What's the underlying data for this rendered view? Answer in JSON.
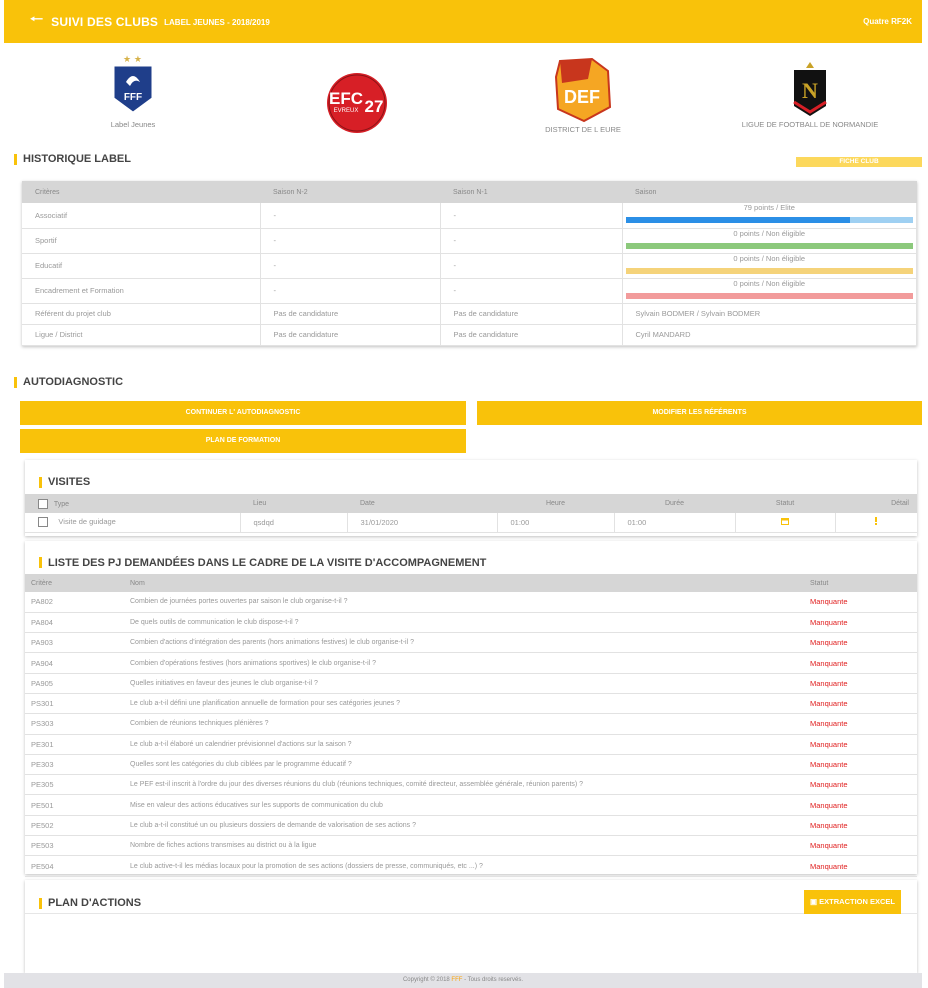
{
  "header": {
    "back_icon": "arrow-left-icon",
    "title": "SUIVI DES CLUBS",
    "subtitle": "LABEL JEUNES - 2018/2019",
    "user": "Quatre RF2K"
  },
  "logos": [
    {
      "name": "FFF",
      "caption": "Label Jeunes"
    },
    {
      "name": "EFC 27",
      "caption": ""
    },
    {
      "name": "DEF",
      "caption": "DISTRICT DE L EURE"
    },
    {
      "name": "N",
      "caption": "LIGUE DE FOOTBALL DE NORMANDIE"
    }
  ],
  "historique": {
    "title": "HISTORIQUE LABEL",
    "fiche_button": "FICHE CLUB",
    "headers": [
      "Critères",
      "Saison N-2",
      "Saison N-1",
      "Saison"
    ],
    "progress_rows": [
      {
        "critere": "Associatif",
        "n2": "-",
        "n1": "-",
        "label": "79 points / Elite",
        "fill": 0.78,
        "color": "#2b8fe6",
        "track": "#9fd0f2"
      },
      {
        "critere": "Sportif",
        "n2": "-",
        "n1": "-",
        "label": "0 points / Non éligible",
        "fill": 0,
        "color": "#8cc97c",
        "track": "#8cc97c"
      },
      {
        "critere": "Educatif",
        "n2": "-",
        "n1": "-",
        "label": "0 points / Non éligible",
        "fill": 0,
        "color": "#f5d37a",
        "track": "#f5d37a"
      },
      {
        "critere": "Encadrement et Formation",
        "n2": "-",
        "n1": "-",
        "label": "0 points / Non éligible",
        "fill": 0,
        "color": "#f29b9b",
        "track": "#f29b9b"
      }
    ],
    "text_rows": [
      {
        "critere": "Référent du projet club",
        "n2": "Pas de candidature",
        "n1": "Pas de candidature",
        "saison": "Sylvain BODMER / Sylvain BODMER"
      },
      {
        "critere": "Ligue / District",
        "n2": "Pas de candidature",
        "n1": "Pas de candidature",
        "saison": "Cyril MANDARD"
      }
    ]
  },
  "autodiagnostic": {
    "title": "AUTODIAGNOSTIC",
    "continuer": "CONTINUER L' AUTODIAGNOSTIC",
    "modifier": "MODIFIER LES RÉFÉRENTS",
    "plan": "PLAN DE FORMATION"
  },
  "visites": {
    "title": "VISITES",
    "headers": [
      "Type",
      "Lieu",
      "Date",
      "Heure",
      "Durée",
      "Statut",
      "Détail"
    ],
    "rows": [
      {
        "type": "Visite de guidage",
        "lieu": "qsdqd",
        "date": "31/01/2020",
        "heure": "01:00",
        "duree": "01:00",
        "statut_icon": "calendar-icon",
        "detail_icon": "exclamation-icon"
      }
    ]
  },
  "pj": {
    "title": "LISTE DES PJ DEMANDÉES DANS LE CADRE DE LA VISITE D'ACCOMPAGNEMENT",
    "headers": [
      "Critère",
      "Nom",
      "Statut"
    ],
    "rows": [
      {
        "code": "PA802",
        "nom": "Combien de journées portes ouvertes par saison le club organise-t-il ?",
        "statut": "Manquante"
      },
      {
        "code": "PA804",
        "nom": "De quels outils de communication le club dispose-t-il ?",
        "statut": "Manquante"
      },
      {
        "code": "PA903",
        "nom": "Combien d'actions d'intégration des parents (hors animations festives) le club organise-t-il ?",
        "statut": "Manquante"
      },
      {
        "code": "PA904",
        "nom": "Combien d'opérations festives (hors animations sportives) le club organise-t-il ?",
        "statut": "Manquante"
      },
      {
        "code": "PA905",
        "nom": "Quelles initiatives en faveur des jeunes le club organise-t-il ?",
        "statut": "Manquante"
      },
      {
        "code": "PS301",
        "nom": "Le club a-t-il défini une planification annuelle de formation pour ses catégories jeunes ?",
        "statut": "Manquante"
      },
      {
        "code": "PS303",
        "nom": "Combien de réunions techniques plénières ?",
        "statut": "Manquante"
      },
      {
        "code": "PE301",
        "nom": "Le club a-t-il élaboré un calendrier prévisionnel d'actions sur la saison ?",
        "statut": "Manquante"
      },
      {
        "code": "PE303",
        "nom": "Quelles sont les catégories du club ciblées par le programme éducatif ?",
        "statut": "Manquante"
      },
      {
        "code": "PE305",
        "nom": "Le PEF est-il inscrit à l'ordre du jour des diverses réunions du club (réunions techniques, comité directeur, assemblée générale, réunion parents) ?",
        "statut": "Manquante"
      },
      {
        "code": "PE501",
        "nom": "Mise en valeur des actions éducatives sur les supports de communication du club",
        "statut": "Manquante"
      },
      {
        "code": "PE502",
        "nom": "Le club a-t-il constitué un ou plusieurs dossiers de demande de valorisation de ses actions ?",
        "statut": "Manquante"
      },
      {
        "code": "PE503",
        "nom": "Nombre de fiches actions transmises au district ou à la ligue",
        "statut": "Manquante"
      },
      {
        "code": "PE504",
        "nom": "Le club active-t-il les médias locaux pour la promotion de ses actions (dossiers de presse, communiqués, etc ...) ?",
        "statut": "Manquante"
      }
    ]
  },
  "plan_actions": {
    "title": "PLAN D'ACTIONS",
    "excel_button": "EXTRACTION EXCEL",
    "excel_icon": "file-excel-icon"
  },
  "footer": {
    "prefix": "Copyright © 2018",
    "brand": "FFF",
    "suffix": "- Tous droits reservés."
  }
}
